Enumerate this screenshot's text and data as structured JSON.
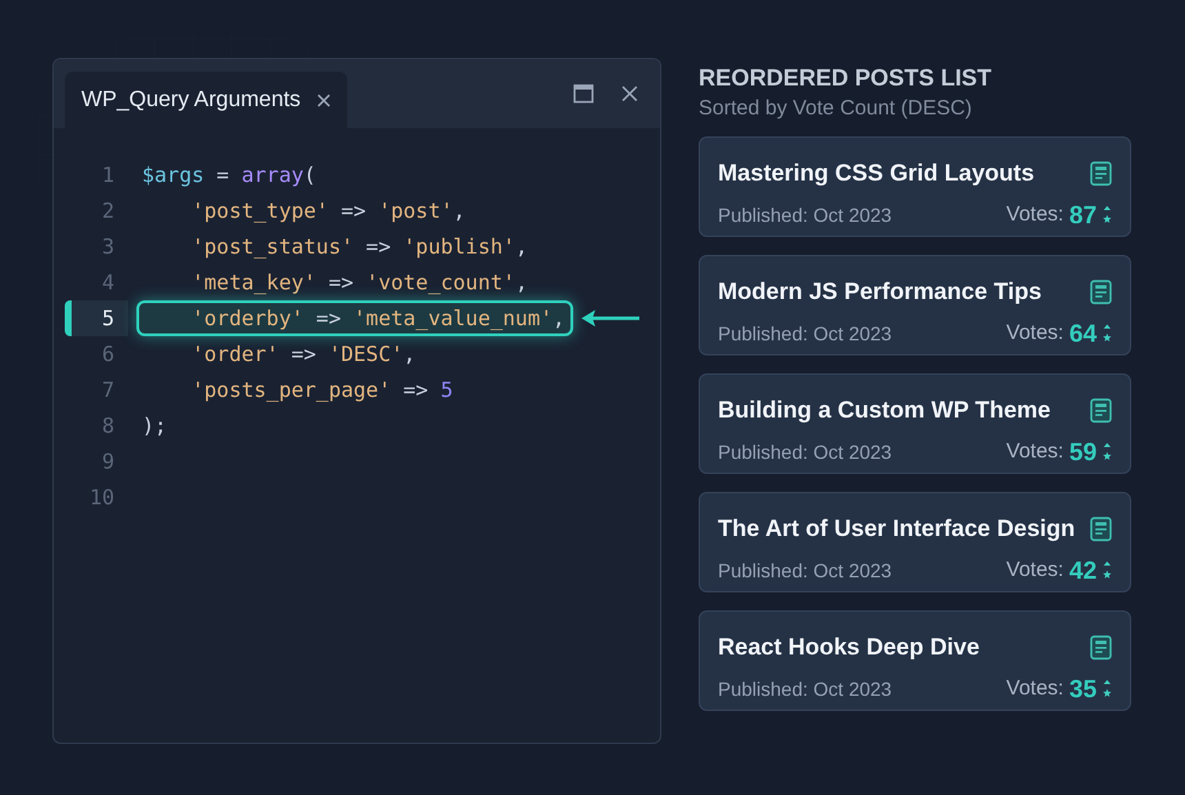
{
  "editor": {
    "tab": {
      "label": "WP_Query Arguments",
      "selected": true
    },
    "lines": [
      {
        "number": "1",
        "highlighted": false,
        "tokens": [
          {
            "kind": "var",
            "text": "$args"
          },
          {
            "kind": "op",
            "text": " = "
          },
          {
            "kind": "fn",
            "text": "array"
          },
          {
            "kind": "op",
            "text": "("
          }
        ]
      },
      {
        "number": "2",
        "highlighted": false,
        "tokens": [
          {
            "kind": "str",
            "text": "    'post_type'"
          },
          {
            "kind": "op",
            "text": " => "
          },
          {
            "kind": "str",
            "text": "'post'"
          },
          {
            "kind": "op",
            "text": ","
          }
        ]
      },
      {
        "number": "3",
        "highlighted": false,
        "tokens": [
          {
            "kind": "str",
            "text": "    'post_status'"
          },
          {
            "kind": "op",
            "text": " => "
          },
          {
            "kind": "str",
            "text": "'publish'"
          },
          {
            "kind": "op",
            "text": ","
          }
        ]
      },
      {
        "number": "4",
        "highlighted": false,
        "tokens": [
          {
            "kind": "str",
            "text": "    'meta_key'"
          },
          {
            "kind": "op",
            "text": " => "
          },
          {
            "kind": "str",
            "text": "'vote_count'"
          },
          {
            "kind": "op",
            "text": ","
          }
        ]
      },
      {
        "number": "5",
        "highlighted": true,
        "tokens": [
          {
            "kind": "str",
            "text": "    'orderby'"
          },
          {
            "kind": "op",
            "text": " => "
          },
          {
            "kind": "str",
            "text": "'meta_value_num'"
          },
          {
            "kind": "op",
            "text": ","
          }
        ]
      },
      {
        "number": "6",
        "highlighted": false,
        "tokens": [
          {
            "kind": "str",
            "text": "    'order'"
          },
          {
            "kind": "op",
            "text": " => "
          },
          {
            "kind": "str",
            "text": "'DESC'"
          },
          {
            "kind": "op",
            "text": ","
          }
        ]
      },
      {
        "number": "7",
        "highlighted": false,
        "tokens": [
          {
            "kind": "str",
            "text": "    'posts_per_page'"
          },
          {
            "kind": "op",
            "text": " => "
          },
          {
            "kind": "num",
            "text": "5"
          }
        ]
      },
      {
        "number": "8",
        "highlighted": false,
        "tokens": [
          {
            "kind": "op",
            "text": ");"
          }
        ]
      },
      {
        "number": "9",
        "highlighted": false
      },
      {
        "number": "10",
        "highlighted": false
      }
    ]
  },
  "posts_panel": {
    "title": "REORDERED POSTS LIST",
    "subtitle": "Sorted by Vote Count (DESC)",
    "posts": [
      {
        "title": "Mastering CSS Grid Layouts",
        "published": "Published: Oct 2023",
        "votes_label": "Votes:",
        "votes": "87"
      },
      {
        "title": "Modern JS Performance Tips",
        "published": "Published: Oct 2023",
        "votes_label": "Votes:",
        "votes": "64"
      },
      {
        "title": "Building a Custom WP Theme",
        "published": "Published: Oct 2023",
        "votes_label": "Votes:",
        "votes": "59"
      },
      {
        "title": "The Art of User Interface Design",
        "published": "Published: Oct 2023",
        "votes_label": "Votes:",
        "votes": "42"
      },
      {
        "title": "React Hooks Deep Dive",
        "published": "Published: Oct 2023",
        "votes_label": "Votes:",
        "votes": "35"
      }
    ]
  }
}
